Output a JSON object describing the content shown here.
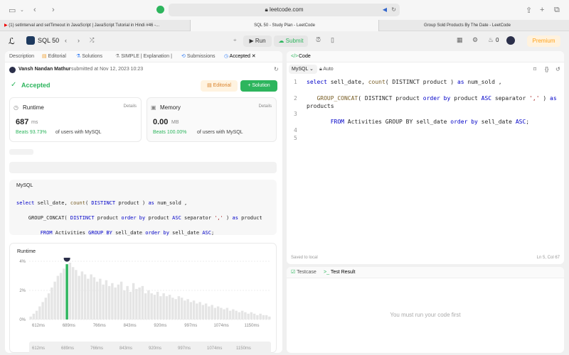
{
  "browser": {
    "url": "leetcode.com",
    "tabs": [
      {
        "title": "(1) setInterval and setTimeout in JavaScript | JavaScript Tutorial in Hindi #46 -..."
      },
      {
        "title": "SQL 50 - Study Plan - LeetCode"
      },
      {
        "title": "Group Sold Products By The Date - LeetCode"
      }
    ]
  },
  "nav": {
    "list_title": "SQL 50",
    "run": "Run",
    "submit": "Submit",
    "streak": "0",
    "premium": "Premium"
  },
  "left_tabs": [
    "Description",
    "Editorial",
    "Solutions",
    "SIMPLE | Explanation |",
    "Submissions",
    "Accepted"
  ],
  "submission": {
    "user": "Vansh Nandan Mathur",
    "meta": "submitted at Nov 12, 2023 10:23",
    "status": "Accepted",
    "editorial_btn": "Editorial",
    "solution_btn": "+ Solution"
  },
  "runtime": {
    "label": "Runtime",
    "details": "Details",
    "value": "687",
    "unit": "ms",
    "beats_pct": "Beats 93.73%",
    "beats_rest": "of users with MySQL"
  },
  "memory": {
    "label": "Memory",
    "details": "Details",
    "value": "0.00",
    "unit": "MB",
    "beats_pct": "Beats 100.00%",
    "beats_rest": "of users with MySQL"
  },
  "lang_label": "MySQL",
  "chart_title": "Runtime",
  "chart_data": {
    "type": "bar",
    "title": "Runtime",
    "x_ticks": [
      "612ms",
      "689ms",
      "766ms",
      "843ms",
      "920ms",
      "997ms",
      "1074ms",
      "1150ms"
    ],
    "y_ticks": [
      "4%",
      "2%",
      "0%"
    ],
    "ylim": [
      0,
      4
    ],
    "values": [
      0.2,
      0.4,
      0.6,
      0.9,
      1.2,
      1.5,
      1.8,
      2.2,
      2.6,
      3.0,
      3.2,
      3.5,
      3.8,
      3.9,
      3.6,
      3.4,
      3.0,
      3.3,
      3.1,
      2.8,
      3.1,
      2.9,
      2.6,
      2.8,
      2.4,
      2.7,
      2.3,
      2.5,
      2.2,
      2.4,
      2.6,
      2.0,
      2.3,
      1.9,
      2.5,
      2.1,
      2.2,
      2.3,
      1.8,
      2.0,
      1.8,
      1.7,
      1.9,
      1.6,
      1.8,
      1.6,
      1.7,
      1.5,
      1.4,
      1.6,
      1.5,
      1.3,
      1.4,
      1.2,
      1.3,
      1.1,
      1.2,
      1.0,
      1.1,
      0.9,
      1.0,
      0.8,
      0.9,
      0.8,
      0.7,
      0.8,
      0.6,
      0.7,
      0.6,
      0.5,
      0.6,
      0.5,
      0.4,
      0.5,
      0.4,
      0.3,
      0.4,
      0.3,
      0.3,
      0.2
    ],
    "highlight_index": 12
  },
  "bottom_ticks": [
    "612ms",
    "689ms",
    "766ms",
    "843ms",
    "920ms",
    "997ms",
    "1074ms",
    "1150ms"
  ],
  "code_panel": {
    "title": "Code",
    "lang": "MySQL",
    "auto": "Auto",
    "saved": "Saved to local",
    "position": "Ln 5, Col 67",
    "line_numbers": [
      "1",
      "2",
      "3",
      "4",
      "5"
    ]
  },
  "test_panel": {
    "testcase": "Testcase",
    "result": "Test Result",
    "empty": "You must run your code first"
  },
  "colors": {
    "accent": "#2db55d",
    "brand": "#ffa116"
  }
}
